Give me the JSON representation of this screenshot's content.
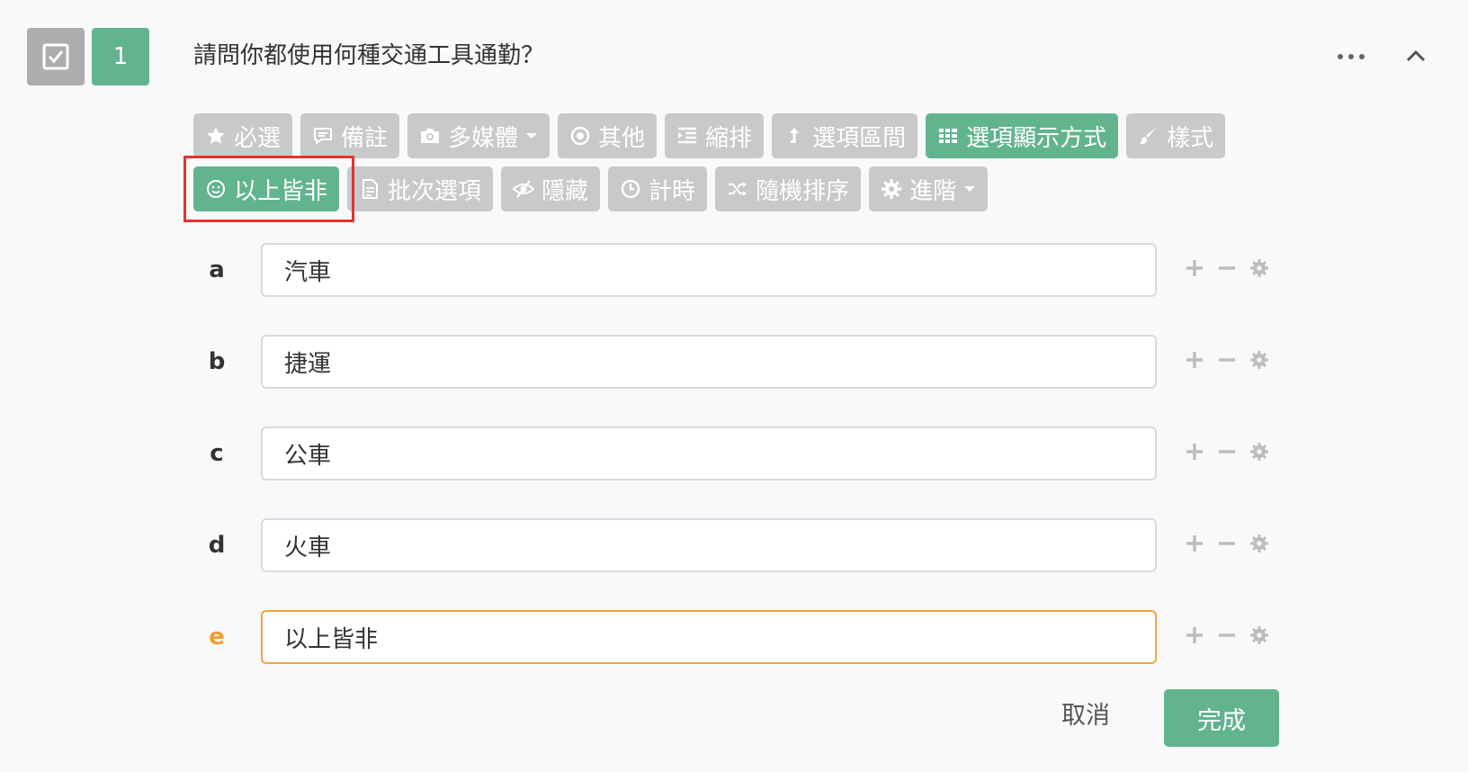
{
  "question": {
    "type_icon": "checkbox-icon",
    "number": "1",
    "title": "請問你都使用何種交通工具通勤？"
  },
  "header_actions": {
    "more_icon": "more-horizontal-icon",
    "collapse_icon": "chevron-up-icon"
  },
  "toolbar": {
    "required": {
      "label": "必選",
      "icon": "star-icon"
    },
    "note": {
      "label": "備註",
      "icon": "comment-icon"
    },
    "media": {
      "label": "多媒體",
      "icon": "camera-icon"
    },
    "other": {
      "label": "其他",
      "icon": "radio-icon"
    },
    "indent": {
      "label": "縮排",
      "icon": "indent-icon"
    },
    "range": {
      "label": "選項區間",
      "icon": "arrow-up-icon"
    },
    "display_mode": {
      "label": "選項顯示方式",
      "icon": "grid-icon",
      "active": true
    },
    "style": {
      "label": "樣式",
      "icon": "brush-icon"
    },
    "none_above": {
      "label": "以上皆非",
      "icon": "smile-icon",
      "active": true
    },
    "batch": {
      "label": "批次選項",
      "icon": "file-icon"
    },
    "hide": {
      "label": "隱藏",
      "icon": "eye-slash-icon"
    },
    "timer": {
      "label": "計時",
      "icon": "clock-icon"
    },
    "random": {
      "label": "隨機排序",
      "icon": "shuffle-icon"
    },
    "advanced": {
      "label": "進階",
      "icon": "gear-icon"
    }
  },
  "options": [
    {
      "letter": "a",
      "value": "汽車"
    },
    {
      "letter": "b",
      "value": "捷運"
    },
    {
      "letter": "c",
      "value": "公車"
    },
    {
      "letter": "d",
      "value": "火車"
    },
    {
      "letter": "e",
      "value": "以上皆非"
    }
  ],
  "footer": {
    "cancel_label": "取消",
    "done_label": "完成"
  },
  "colors": {
    "accent_green": "#62b48e",
    "inactive_gray": "#c9c8cb",
    "highlight_red": "#e0362c",
    "focus_orange": "#f0a53b"
  }
}
